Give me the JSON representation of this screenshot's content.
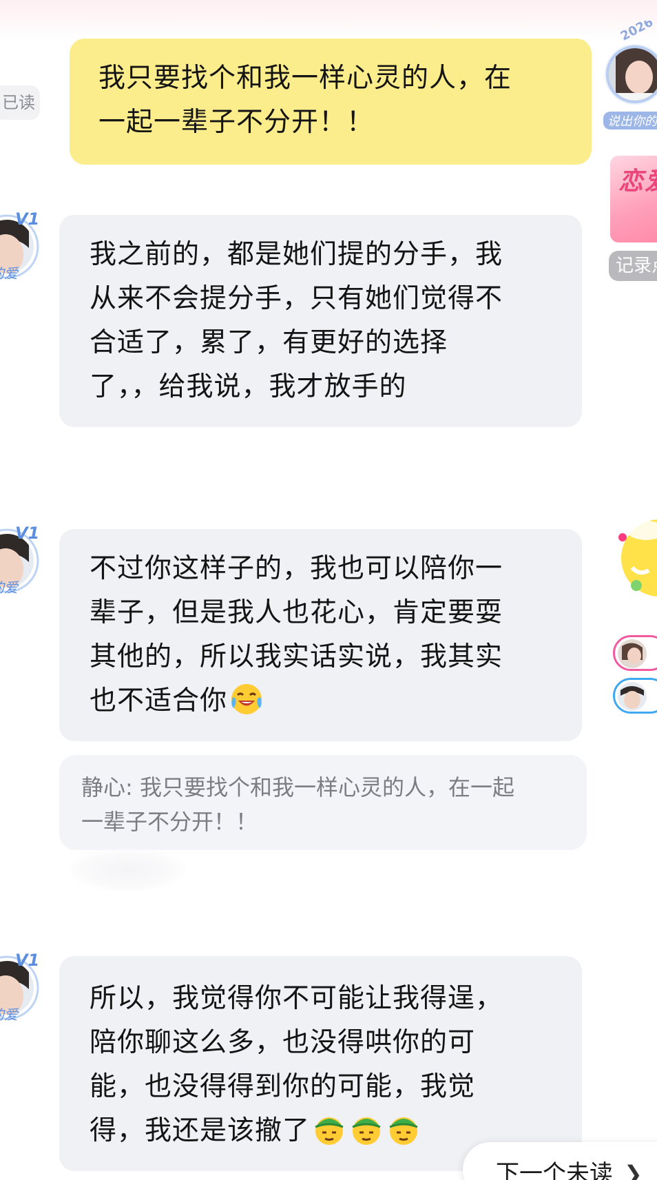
{
  "messages": {
    "me_1": {
      "line1": "我只要找个和我一样心灵的人，在",
      "line2": "一起一辈子不分开！！",
      "read_status": "已读"
    },
    "peer_1": {
      "line1": "我之前的，都是她们提的分手，我",
      "line2": "从来不会提分手，只有她们觉得不",
      "line3": "合适了，累了，有更好的选择",
      "line4": "了，，给我说，我才放手的"
    },
    "peer_2": {
      "line1": "不过你这样子的，我也可以陪你一",
      "line2": "辈子，但是我人也花心，肯定要耍",
      "line3": "其他的，所以我实话实说，我其实",
      "line4": "也不适合你",
      "emoji": "laughing-crying-emoji"
    },
    "quote": {
      "line1": "静心: 我只要找个和我一样心灵的人，在一起",
      "line2": "一辈子不分开！！"
    },
    "peer_3": {
      "line1": "所以，我觉得你不可能让我得逞，",
      "line2": "陪你聊这么多，也没得哄你的可",
      "line3": "能，也没得得到你的可能，我觉",
      "line4": "得，我还是该撤了",
      "emojis": [
        "hat-emoji",
        "hat-emoji",
        "hat-emoji"
      ]
    }
  },
  "widgets": {
    "love_diary_title": "恋爱日记",
    "record_chip": "记录点",
    "next_unread": "下一个未读",
    "next_unread_icon": "chevron-right-icon"
  },
  "colors": {
    "my_bubble": "#fbec8c",
    "peer_bubble": "#f0f1f5",
    "quote_bg": "#f3f4f8",
    "quote_text": "#7b7d85"
  }
}
